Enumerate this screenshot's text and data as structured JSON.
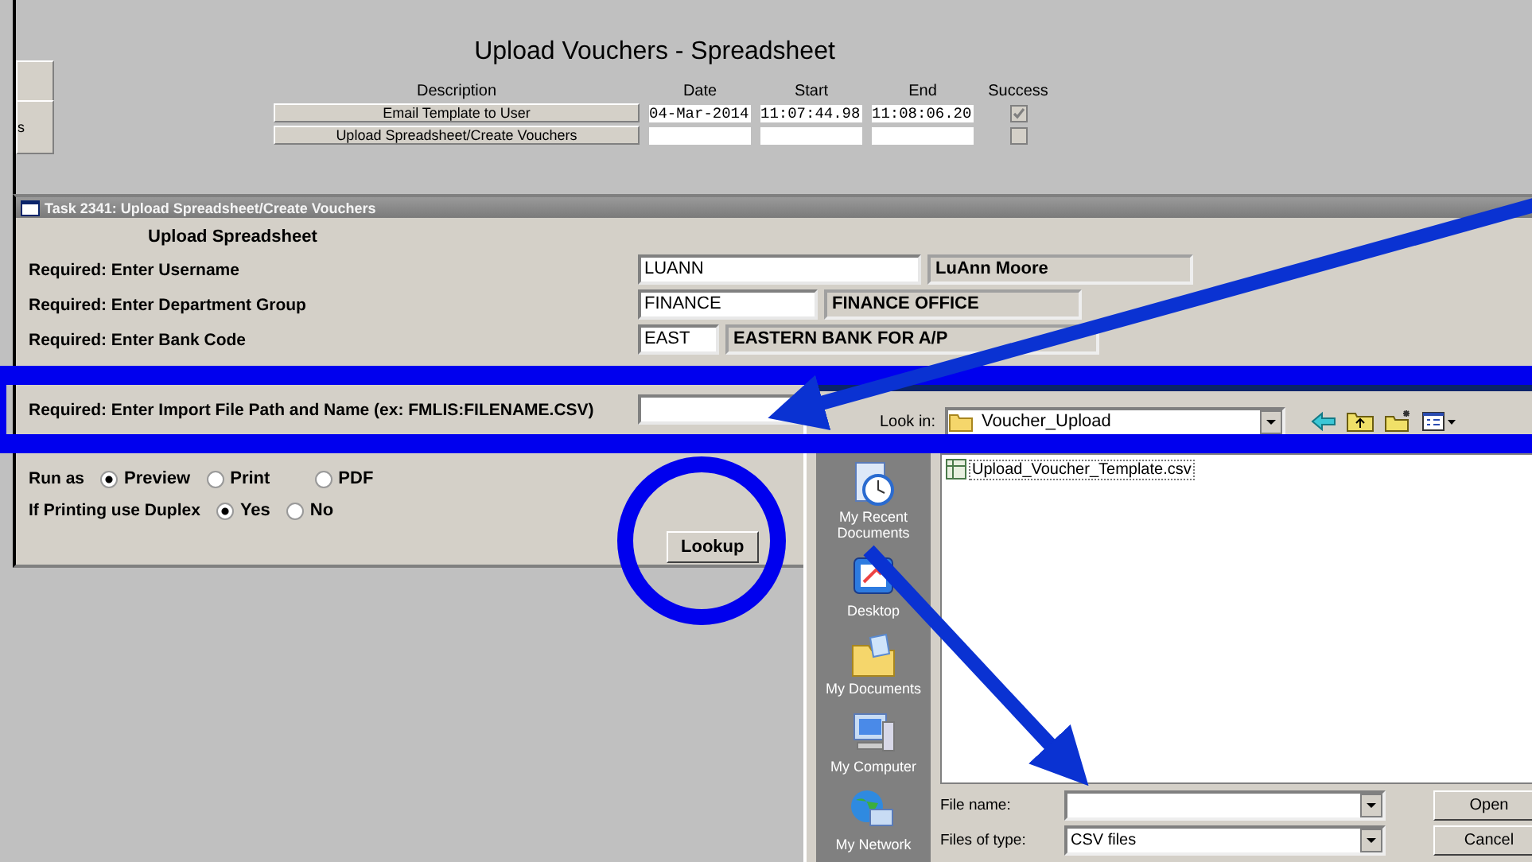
{
  "title": "Upload Vouchers - Spreadsheet",
  "side_button_text": "s",
  "steps": {
    "columns": [
      "Description",
      "Date",
      "Start",
      "End",
      "Success"
    ],
    "rows": [
      {
        "description": "Email Template to User",
        "date": "04-Mar-2014",
        "start": "11:07:44.98",
        "end": "11:08:06.20",
        "success": true
      },
      {
        "description": "Upload Spreadsheet/Create Vouchers",
        "success": false
      }
    ]
  },
  "task": {
    "title": "Task 2341: Upload Spreadsheet/Create Vouchers",
    "heading": "Upload Spreadsheet",
    "fields": [
      {
        "label": "Required: Enter Username",
        "value": "LUANN",
        "description": "LuAnn Moore"
      },
      {
        "label": "Required: Enter Department Group",
        "value": "FINANCE",
        "description": "FINANCE OFFICE"
      },
      {
        "label": "Required: Enter Bank Code",
        "value": "EAST",
        "description": "EASTERN BANK FOR A/P"
      }
    ],
    "import_label": "Required: Enter Import File Path and Name (ex: FMLIS:FILENAME.CSV)",
    "run_as": {
      "label": "Run as",
      "options": [
        {
          "label": "Preview",
          "selected": true
        },
        {
          "label": "Print",
          "selected": false
        },
        {
          "label": "PDF",
          "selected": false
        }
      ]
    },
    "duplex": {
      "label": "If Printing use Duplex",
      "options": [
        {
          "label": "Yes",
          "selected": true
        },
        {
          "label": "No",
          "selected": false
        }
      ]
    },
    "lookup_button": "Lookup"
  },
  "dialog": {
    "look_in_label": "Look in:",
    "folder": "Voucher_Upload",
    "files": [
      "Upload_Voucher_Template.csv"
    ],
    "places": [
      "My Recent Documents",
      "Desktop",
      "My Documents",
      "My Computer",
      "My Network"
    ],
    "file_name_label": "File name:",
    "files_of_type_label": "Files of type:",
    "file_type": "CSV files",
    "buttons": [
      "Open",
      "Cancel"
    ]
  }
}
